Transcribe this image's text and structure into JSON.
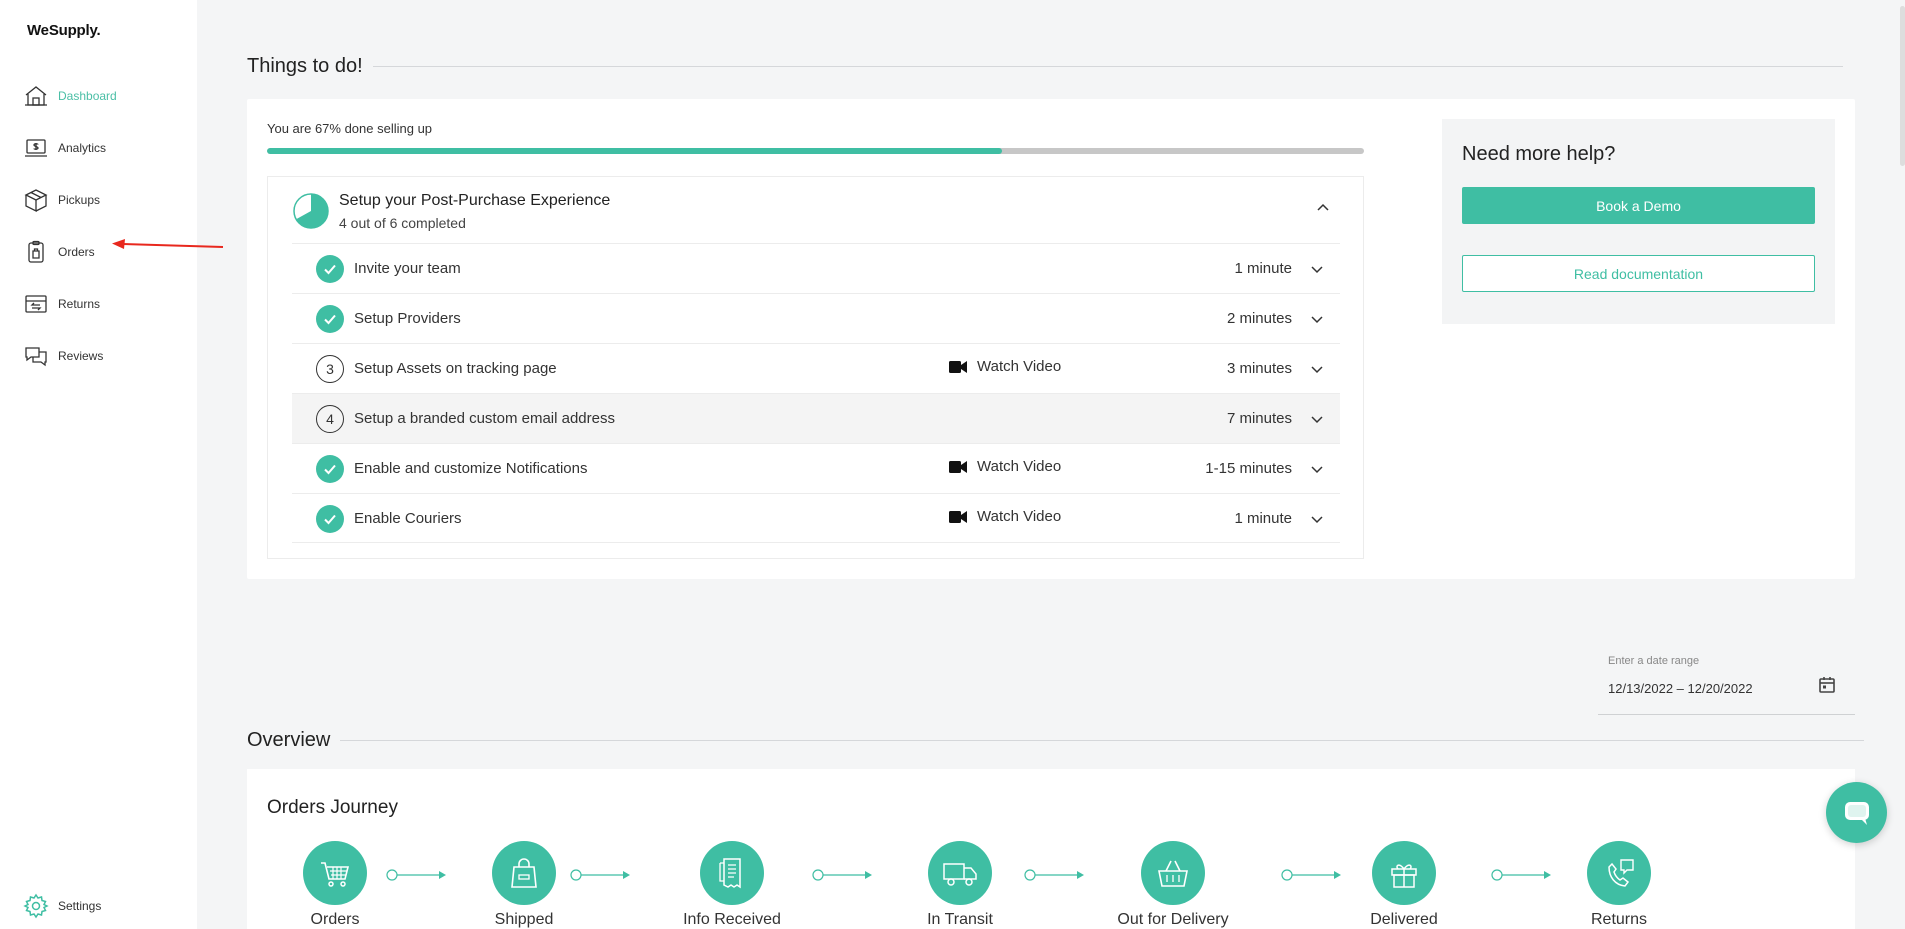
{
  "app": {
    "brand": "WeSupply."
  },
  "sidebar": {
    "items": [
      {
        "label": "Dashboard",
        "icon": "dashboard-icon",
        "active": true
      },
      {
        "label": "Analytics",
        "icon": "analytics-icon"
      },
      {
        "label": "Pickups",
        "icon": "pickups-icon"
      },
      {
        "label": "Orders",
        "icon": "orders-icon"
      },
      {
        "label": "Returns",
        "icon": "returns-icon"
      },
      {
        "label": "Reviews",
        "icon": "reviews-icon"
      }
    ],
    "settings": {
      "label": "Settings",
      "icon": "gear-icon"
    }
  },
  "todo": {
    "title": "Things to do!",
    "progress_text": "You are 67% done selling up",
    "progress": 0.67,
    "setup": {
      "title": "Setup your Post-Purchase Experience",
      "subtitle": "4 out of 6 completed",
      "completed_fraction": 0.67,
      "tasks": [
        {
          "step": "1",
          "name": "Invite your team",
          "done": true,
          "video": "",
          "duration": "1 minute"
        },
        {
          "step": "2",
          "name": "Setup Providers",
          "done": true,
          "video": "",
          "duration": "2 minutes"
        },
        {
          "step": "3",
          "name": "Setup Assets on tracking page",
          "done": false,
          "video": "Watch Video",
          "duration": "3 minutes"
        },
        {
          "step": "4",
          "name": "Setup a branded custom email address",
          "done": false,
          "video": "",
          "duration": "7 minutes"
        },
        {
          "step": "5",
          "name": "Enable and customize Notifications",
          "done": true,
          "video": "Watch Video",
          "duration": "1-15 minutes"
        },
        {
          "step": "6",
          "name": "Enable Couriers",
          "done": true,
          "video": "Watch Video",
          "duration": "1 minute"
        }
      ]
    },
    "help": {
      "title": "Need more help?",
      "demo_label": "Book a Demo",
      "docs_label": "Read documentation"
    }
  },
  "date_range": {
    "label": "Enter a date range",
    "value": "12/13/2022 – 12/20/2022"
  },
  "overview": {
    "title": "Overview",
    "journey_title": "Orders Journey",
    "steps": [
      {
        "label": "Orders",
        "icon": "cart-icon"
      },
      {
        "label": "Shipped",
        "icon": "shopping-bag-icon"
      },
      {
        "label": "Info Received",
        "icon": "receipt-icon"
      },
      {
        "label": "In Transit",
        "icon": "truck-icon"
      },
      {
        "label": "Out for Delivery",
        "icon": "basket-icon"
      },
      {
        "label": "Delivered",
        "icon": "gift-icon"
      },
      {
        "label": "Returns",
        "icon": "phone-return-icon"
      }
    ]
  },
  "colors": {
    "accent": "#3fbea3",
    "arrow": "#e8281e"
  }
}
